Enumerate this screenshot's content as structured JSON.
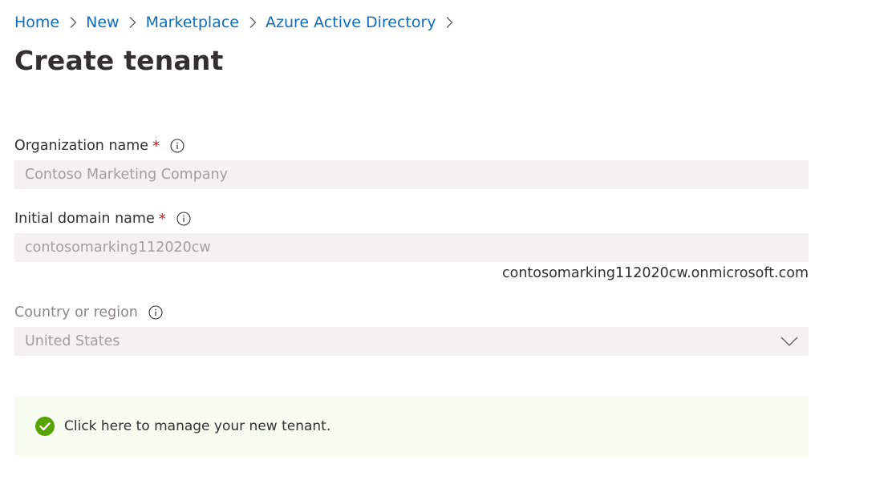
{
  "breadcrumb": {
    "items": [
      "Home",
      "New",
      "Marketplace",
      "Azure Active Directory"
    ]
  },
  "page": {
    "title": "Create tenant"
  },
  "form": {
    "org_name": {
      "label": "Organization name",
      "required_mark": "*",
      "value": "Contoso Marketing Company"
    },
    "domain_name": {
      "label": "Initial domain name",
      "required_mark": "*",
      "value": "contosomarking112020cw",
      "full_domain": "contosomarking112020cw.onmicrosoft.com"
    },
    "country": {
      "label": "Country or region",
      "selected": "United States"
    }
  },
  "banner": {
    "text": "Click here to manage your new tenant.",
    "icon": "check-circle-icon"
  },
  "colors": {
    "link": "#0f6cbd",
    "required": "#a4262c",
    "success": "#57a300",
    "banner_bg": "#f6fdf0",
    "input_bg": "#f3f2f1"
  }
}
